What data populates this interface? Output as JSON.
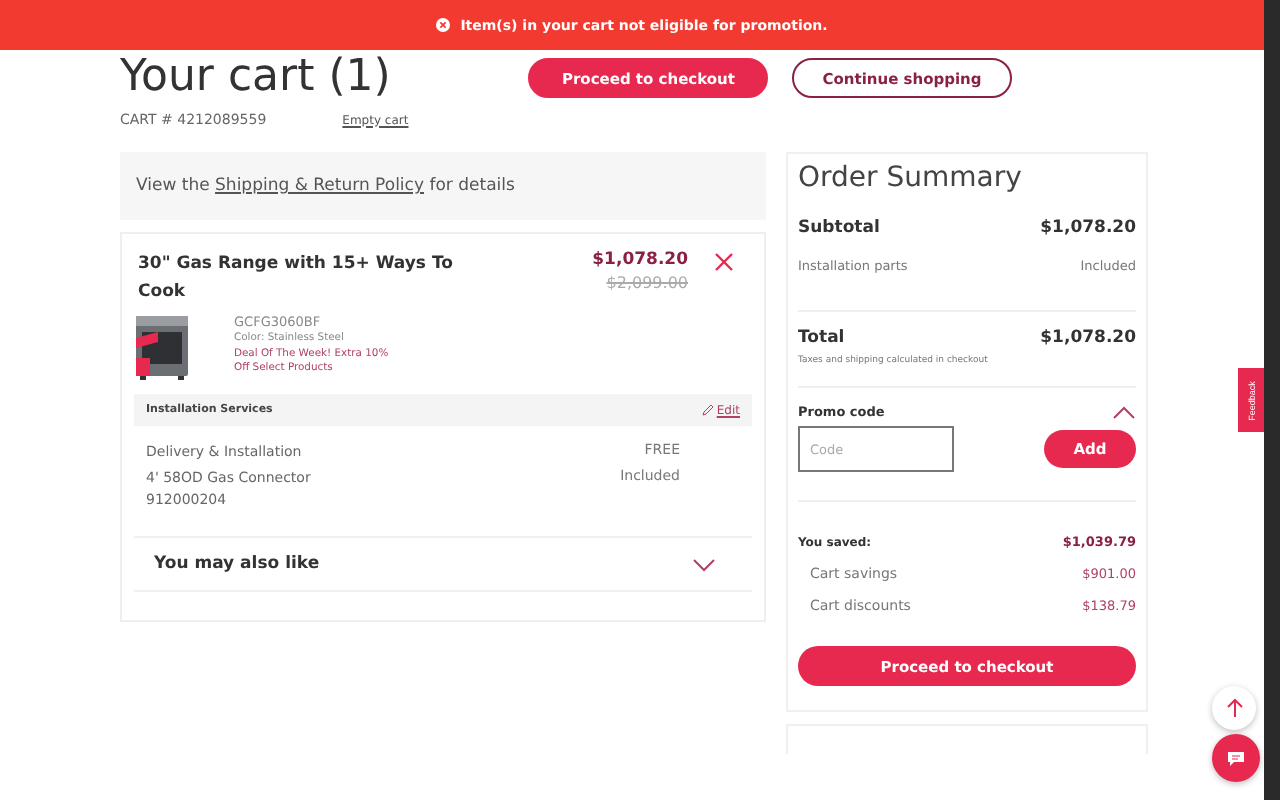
{
  "banner": {
    "message": "Item(s) in your cart not eligible for promotion."
  },
  "header": {
    "title": "Your cart (1)",
    "cart_number": "CART # 4212089559",
    "empty_cart": "Empty cart",
    "buttons": [
      {
        "label": "Proceed to checkout",
        "kind": "primary"
      },
      {
        "label": "Continue shopping",
        "kind": "outline"
      }
    ]
  },
  "policy": {
    "prefix": "View the",
    "link": "Shipping & Return Policy",
    "suffix": "for details"
  },
  "item": {
    "name": "30\" Gas Range with 15+ Ways To Cook",
    "price": "$1,078.20",
    "old_price": "$2,099.00",
    "model": "GCFG3060BF",
    "finish": "Color: Stainless Steel",
    "promo": "Deal Of The Week! Extra 10% Off Select Products",
    "services": {
      "title": "Installation Services",
      "edit": "Edit",
      "rows": [
        {
          "name": "Delivery & Installation",
          "value": "FREE"
        },
        {
          "name": "4' 58OD Gas Connector\n912000204",
          "value": "Included"
        }
      ]
    },
    "also_like": {
      "label": "You may also like",
      "expanded": false
    }
  },
  "summary": {
    "title": "Order Summary",
    "subtotal": {
      "label": "Subtotal",
      "value": "$1,078.20"
    },
    "installation": {
      "label": "Installation parts",
      "value": "Included"
    },
    "total": {
      "label": "Total",
      "value": "$1,078.20",
      "note": "Taxes and shipping calculated in checkout"
    },
    "promo": {
      "label": "Promo code",
      "expanded": true,
      "placeholder": "Code",
      "button": "Add"
    },
    "saved": {
      "label": "You saved:",
      "value": "$1,039.79",
      "rows": [
        {
          "label": "Cart savings",
          "value": "$901.00"
        },
        {
          "label": "Cart discounts",
          "value": "$138.79"
        }
      ]
    },
    "checkout": "Proceed to checkout"
  },
  "feedback": "Feedback"
}
